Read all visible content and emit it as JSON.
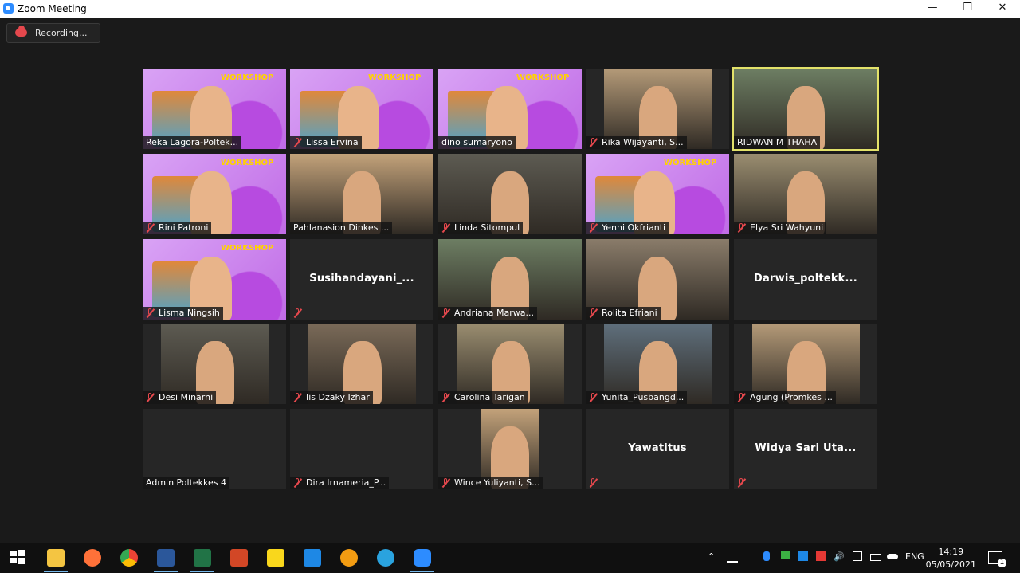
{
  "window": {
    "title": "Zoom Meeting",
    "minimize": "—",
    "restore": "❐",
    "close": "✕"
  },
  "recording": {
    "label": "Recording..."
  },
  "workshop_label": "WORKSHOP",
  "tiles": [
    {
      "name": "Reka Lagora-Poltek...",
      "muted": false,
      "video": "workshop"
    },
    {
      "name": "Lissa Ervina",
      "muted": true,
      "video": "workshop"
    },
    {
      "name": "dino sumaryono",
      "muted": false,
      "video": "workshop"
    },
    {
      "name": "Rika Wijayanti, S...",
      "muted": true,
      "video": "camera"
    },
    {
      "name": "RIDWAN M THAHA",
      "muted": false,
      "video": "camera",
      "active": true
    },
    {
      "name": "Rini Patroni",
      "muted": true,
      "video": "workshop"
    },
    {
      "name": "Pahlanasion Dinkes ...",
      "muted": false,
      "video": "camera"
    },
    {
      "name": "Linda Sitompul",
      "muted": true,
      "video": "camera"
    },
    {
      "name": "Yenni Okfrianti",
      "muted": true,
      "video": "workshop"
    },
    {
      "name": "Elya Sri Wahyuni",
      "muted": true,
      "video": "camera"
    },
    {
      "name": "Lisma Ningsih",
      "muted": true,
      "video": "workshop"
    },
    {
      "name": "",
      "muted": true,
      "video": "none",
      "big_name": "Susihandayani_..."
    },
    {
      "name": "Andriana Marwa...",
      "muted": true,
      "video": "camera"
    },
    {
      "name": "Rolita Efriani",
      "muted": true,
      "video": "camera"
    },
    {
      "name": "",
      "muted": false,
      "video": "none",
      "big_name": "Darwis_poltekk..."
    },
    {
      "name": "Desi Minarni",
      "muted": true,
      "video": "camera"
    },
    {
      "name": "Iis Dzaky Izhar",
      "muted": true,
      "video": "camera"
    },
    {
      "name": "Carolina Tarigan",
      "muted": true,
      "video": "camera"
    },
    {
      "name": "Yunita_Pusbangd...",
      "muted": true,
      "video": "camera"
    },
    {
      "name": "Agung (Promkes ...",
      "muted": true,
      "video": "camera"
    },
    {
      "name": "Admin Poltekkes 4",
      "muted": false,
      "video": "none"
    },
    {
      "name": "Dira Irnameria_P...",
      "muted": true,
      "video": "none"
    },
    {
      "name": "Wince Yuliyanti, S...",
      "muted": true,
      "video": "camera"
    },
    {
      "name": "",
      "muted": true,
      "video": "none",
      "big_name": "Yawatitus"
    },
    {
      "name": "",
      "muted": true,
      "video": "none",
      "big_name": "Widya Sari Uta..."
    }
  ],
  "taskbar": {
    "apps": [
      "windows-start",
      "file-explorer",
      "firefox",
      "chrome",
      "word",
      "excel",
      "powerpoint",
      "sticky-notes",
      "calendar",
      "vlc",
      "telegram",
      "zoom"
    ],
    "language": "ENG",
    "time": "14:19",
    "date": "05/05/2021",
    "notification_count": "1"
  }
}
